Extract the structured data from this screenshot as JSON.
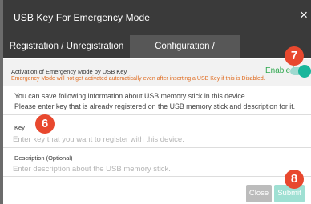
{
  "dialog": {
    "title": "USB Key For Emergency Mode",
    "close_glyph": "×"
  },
  "tabs": [
    {
      "label": "Registration / Unregistration",
      "active": false
    },
    {
      "label": "Configuration / Management",
      "active": true
    }
  ],
  "activation": {
    "title": "Activation of Emergency Mode by USB Key",
    "warning": "Emergency Mode will not get activated automatically even after inserting a USB Key if this is Disabled.",
    "status_label": "Enabled",
    "enabled": true
  },
  "info": {
    "line1": "You can save following information about USB memory stick in this device.",
    "line2": "Please enter key that is already registered on the USB memory stick and description for it."
  },
  "key_field": {
    "label": "Key",
    "value": "",
    "placeholder": "Enter key that you want to register with this device."
  },
  "description_field": {
    "label": "Description (Optional)",
    "value": "",
    "placeholder": "Enter description about the USB memory stick."
  },
  "buttons": {
    "close": "Close",
    "submit": "Submit"
  },
  "badges": {
    "key": "6",
    "toggle": "7",
    "submit": "8"
  },
  "colors": {
    "header_bg": "#3a3a3a",
    "active_tab_bg": "#575757",
    "enabled_green": "#2fa84f",
    "warning_orange": "#e06b1f",
    "toggle_teal": "#19b69b",
    "submit_bg": "#9fe0d3",
    "badge_red": "#e8482e"
  }
}
